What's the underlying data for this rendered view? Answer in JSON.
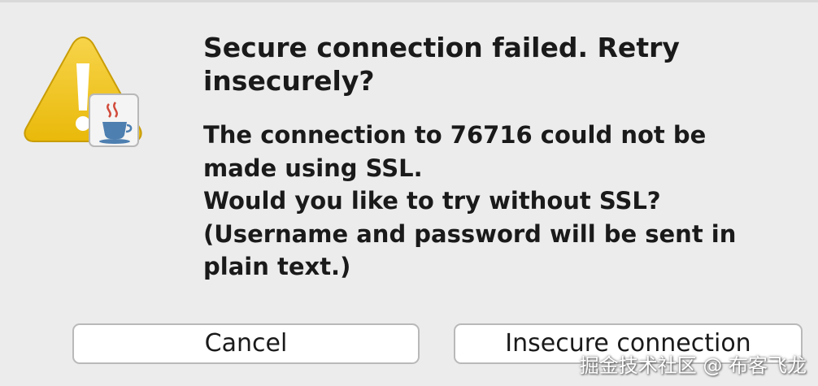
{
  "dialog": {
    "title": "Secure connection failed. Retry\ninsecurely?",
    "body_lines": [
      "The connection to 76716 could not be",
      "made using SSL.",
      "Would you like to try without SSL?",
      "(Username and password will be sent in",
      "plain text.)"
    ],
    "icon": "warning-icon",
    "badge_icon": "java-coffee-cup-icon"
  },
  "buttons": {
    "cancel_label": "Cancel",
    "insecure_label": "Insecure connection"
  },
  "watermark": "掘金技术社区 @ 布客飞龙",
  "colors": {
    "background": "#ececec",
    "warning_yellow": "#f2c40f",
    "button_border": "#b9b9b9",
    "text": "#1a1a1a"
  }
}
